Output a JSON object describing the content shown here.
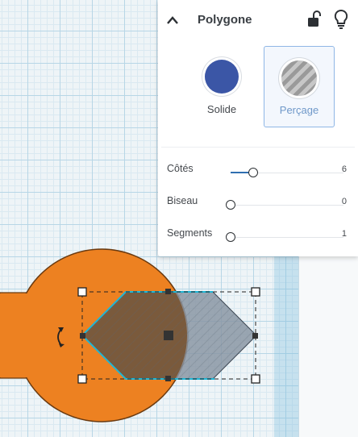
{
  "panel": {
    "title": "Polygone",
    "collapse_icon": "chevron-up-icon",
    "lock_icon": "unlock-icon",
    "bulb_icon": "lightbulb-icon",
    "modes": [
      {
        "label": "Solide",
        "color": "#3b56a6",
        "selected": false
      },
      {
        "label": "Perçage",
        "selected": true
      }
    ],
    "properties": [
      {
        "label": "Côtés",
        "value": "6",
        "fill_fraction": 0.2
      },
      {
        "label": "Biseau",
        "value": "0",
        "fill_fraction": 0.0
      },
      {
        "label": "Segments",
        "value": "1",
        "fill_fraction": 0.0
      }
    ]
  },
  "scene": {
    "shape_color": "#ed8121",
    "selection_color": "#1fb6d6",
    "hole_color": "#8a96a4",
    "rotate_icon": "rotate-arrow-icon"
  }
}
